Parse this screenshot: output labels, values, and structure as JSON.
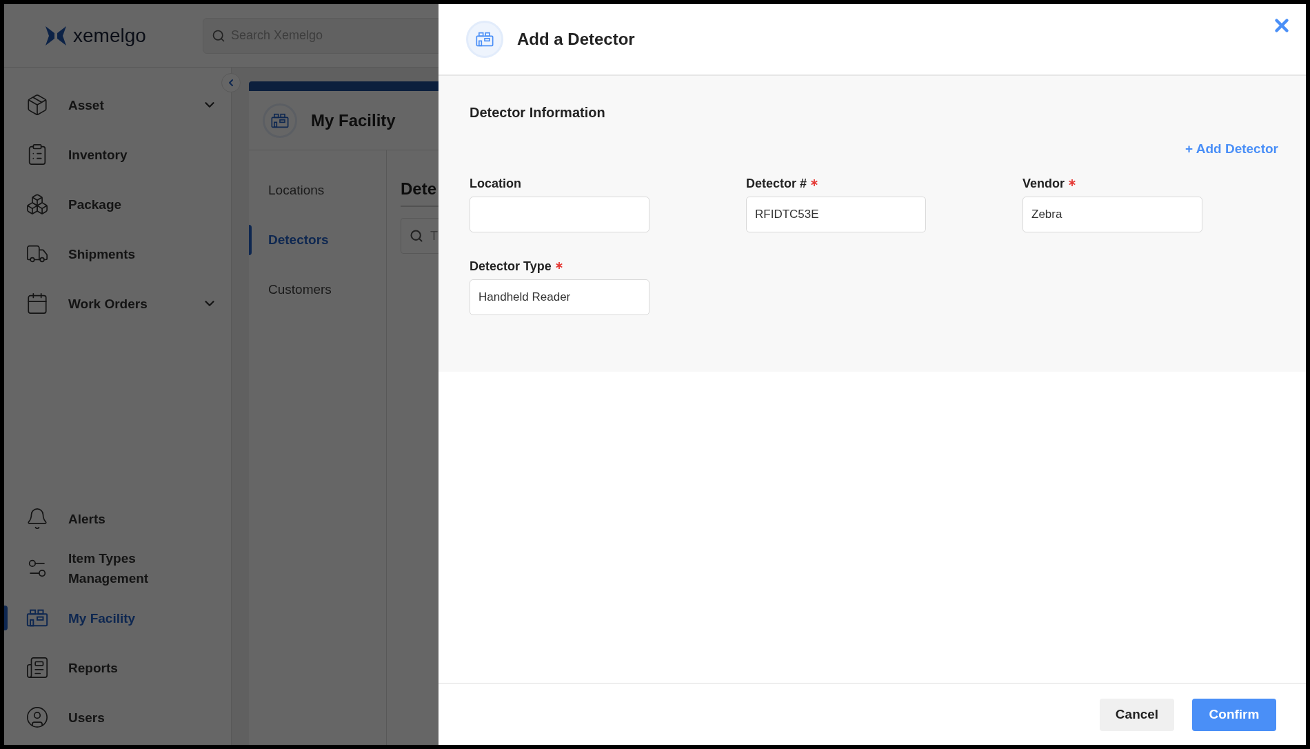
{
  "app": {
    "logo": "xemelgo",
    "search": {
      "placeholder": "Search Xemelgo"
    }
  },
  "sidebar": {
    "top_items": [
      {
        "label": "Asset",
        "expandable": true,
        "selected": false
      },
      {
        "label": "Inventory",
        "expandable": false,
        "selected": false
      },
      {
        "label": "Package",
        "expandable": false,
        "selected": false
      },
      {
        "label": "Shipments",
        "expandable": false,
        "selected": false
      },
      {
        "label": "Work Orders",
        "expandable": true,
        "selected": false
      }
    ],
    "bottom_items": [
      {
        "label": "Alerts",
        "selected": false
      },
      {
        "label": "Item Types Management",
        "selected": false
      },
      {
        "label": "My Facility",
        "selected": true
      },
      {
        "label": "Reports",
        "selected": false
      },
      {
        "label": "Users",
        "selected": false
      }
    ]
  },
  "page": {
    "title": "My Facility",
    "tabs": [
      {
        "label": "Locations",
        "selected": false
      },
      {
        "label": "Detectors",
        "selected": true
      },
      {
        "label": "Customers",
        "selected": false
      }
    ],
    "section_title": "Dete",
    "search": {
      "placeholder": "T"
    }
  },
  "modal": {
    "title": "Add a Detector",
    "section_title": "Detector Information",
    "add_link": "+ Add Detector",
    "fields": [
      {
        "label": "Location",
        "required": false
      },
      {
        "label": "Detector #",
        "required": true,
        "value": "RFIDTC53E"
      },
      {
        "label": "Vendor",
        "required": true,
        "value": "Zebra"
      },
      {
        "label": "Detector Type",
        "required": true,
        "value": "Handheld Reader"
      }
    ],
    "buttons": [
      {
        "label": "Cancel",
        "kind": "secondary"
      },
      {
        "label": "Confirm",
        "kind": "primary"
      }
    ]
  }
}
